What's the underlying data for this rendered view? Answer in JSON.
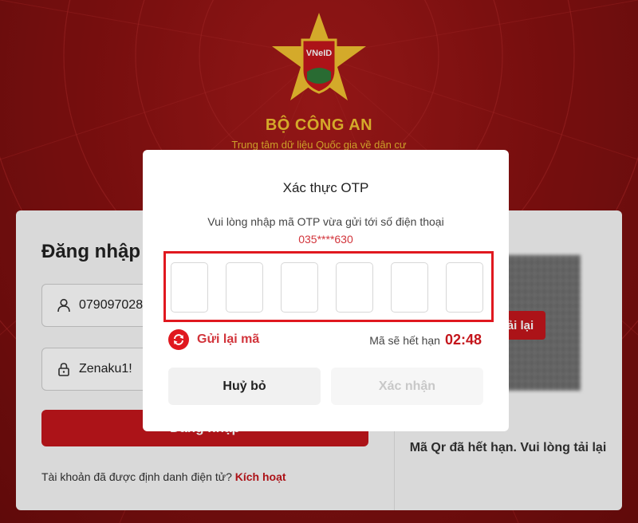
{
  "header": {
    "logo_text": "VNeID",
    "agency": "BỘ CÔNG AN",
    "subtitle": "Trung tâm dữ liệu Quốc gia về dân cư"
  },
  "login": {
    "title": "Đăng nhập V",
    "phone_value": "0790970288",
    "password_value": "Zenaku1!",
    "login_button": "Đăng nhập",
    "activate_prompt": "Tài khoản đã được định danh điện tử?",
    "activate_link": "Kích hoạt"
  },
  "qr": {
    "reload_label": "tải lại",
    "expired_message": "Mã Qr đã hết hạn. Vui lòng tải lại"
  },
  "otp_modal": {
    "title": "Xác thực OTP",
    "instruction": "Vui lòng nhập mã OTP vừa gửi tới số điện thoại",
    "phone_masked": "035****630",
    "digits": [
      "",
      "",
      "",
      "",
      "",
      ""
    ],
    "resend_label": "Gửi lại mã",
    "expire_label": "Mã sẽ hết hạn",
    "countdown": "02:48",
    "cancel_button": "Huỷ bỏ",
    "confirm_button": "Xác nhận"
  },
  "colors": {
    "brand_red": "#c4161c",
    "gold": "#f2c230",
    "highlight_border": "#e0181f"
  },
  "icons": [
    "user-icon",
    "lock-icon",
    "resend-icon",
    "star-emblem-icon"
  ]
}
